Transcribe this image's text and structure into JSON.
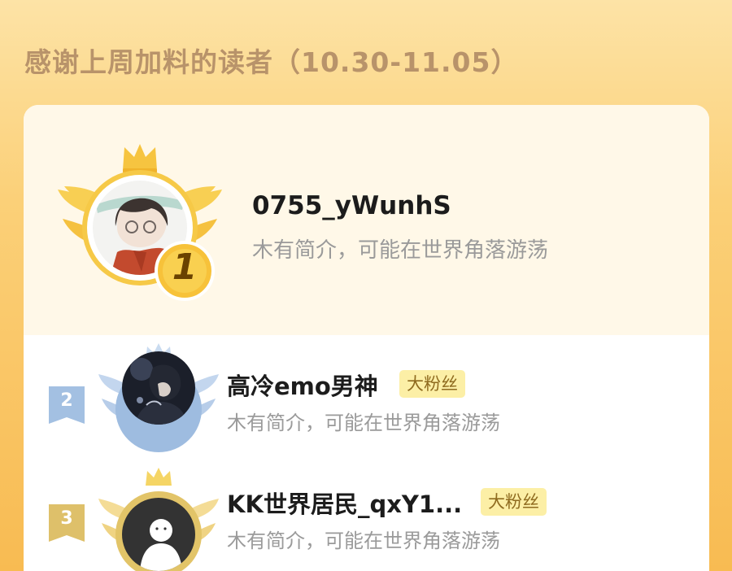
{
  "heading": "感谢上周加料的读者（10.30-11.05）",
  "readers": [
    {
      "rank": "1",
      "name": "0755_yWunhS",
      "bio": "木有简介，可能在世界角落游荡"
    },
    {
      "rank": "2",
      "name": "高冷emo男神",
      "tag": "大粉丝",
      "bio": "木有简介，可能在世界角落游荡"
    },
    {
      "rank": "3",
      "name": "KK世界居民_qxY1...",
      "tag": "大粉丝",
      "bio": "木有简介，可能在世界角落游荡"
    }
  ],
  "colors": {
    "gold": "#f6c440",
    "silver": "#a8c4e4",
    "bronze": "#e7c66e",
    "badge_bg": "#fcefa6",
    "badge_text": "#8f6b1f",
    "heading": "#b8936a"
  }
}
